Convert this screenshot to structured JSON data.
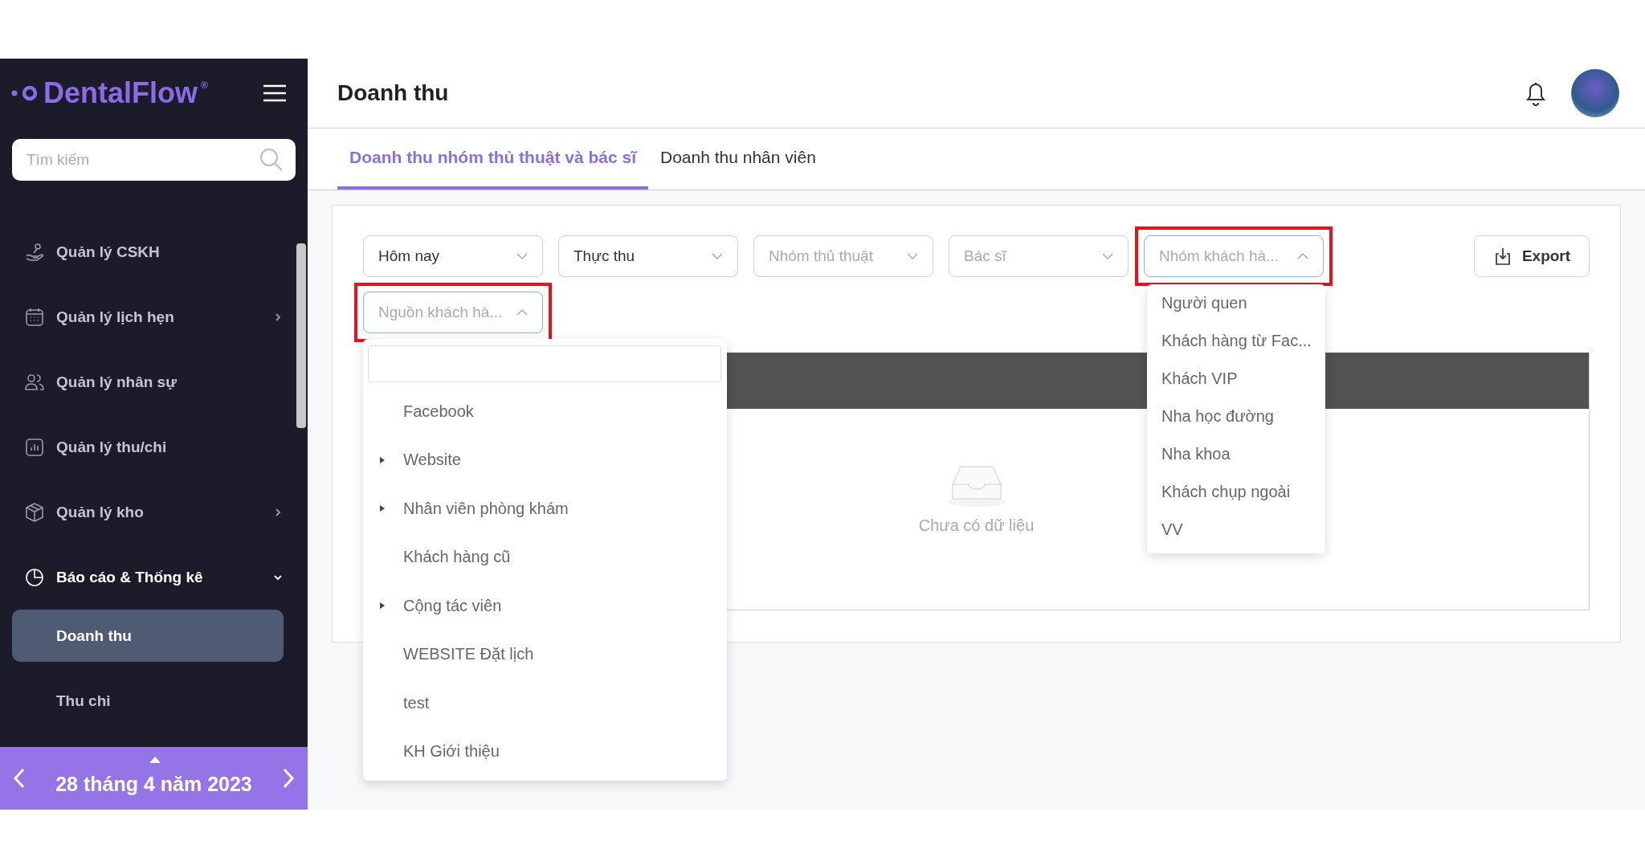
{
  "sidebar": {
    "logo": "DentalFlow",
    "logo_mark": "®",
    "search": {
      "placeholder": "Tìm kiếm"
    },
    "items": [
      {
        "kind": "care",
        "label": "Quản lý CSKH",
        "has_submenu": false,
        "expanded": false
      },
      {
        "kind": "calendar",
        "label": "Quản lý lịch hẹn",
        "has_submenu": true,
        "expanded": false
      },
      {
        "kind": "staff",
        "label": "Quản lý nhân sự",
        "has_submenu": false,
        "expanded": false
      },
      {
        "kind": "finance",
        "label": "Quản lý thu/chi",
        "has_submenu": false,
        "expanded": false
      },
      {
        "kind": "warehouse",
        "label": "Quản lý kho",
        "has_submenu": true,
        "expanded": false
      },
      {
        "kind": "report",
        "label": "Báo cáo & Thống kê",
        "has_submenu": true,
        "expanded": true,
        "children": [
          {
            "label": "Doanh thu",
            "selected": true
          },
          {
            "label": "Thu chi",
            "selected": false
          }
        ]
      }
    ],
    "date": "28 tháng 4 năm 2023"
  },
  "header": {
    "title": "Doanh thu"
  },
  "tabs": [
    {
      "label": "Doanh thu nhóm thủ thuật và bác sĩ",
      "selected": true
    },
    {
      "label": "Doanh thu nhân viên",
      "selected": false
    }
  ],
  "filters": [
    {
      "value": "Hôm nay",
      "open": false,
      "highlighted": false
    },
    {
      "value": "Thực thu",
      "open": false,
      "highlighted": false
    },
    {
      "placeholder": "Nhóm thủ thuật",
      "open": false,
      "highlighted": false
    },
    {
      "placeholder": "Bác sĩ",
      "open": false,
      "highlighted": false
    },
    {
      "placeholder": "Nhóm khách hà...",
      "open": true,
      "highlighted": true,
      "options": [
        {
          "label": "Người quen"
        },
        {
          "label": "Khách hàng từ Fac..."
        },
        {
          "label": "Khách VIP"
        },
        {
          "label": "Nha học đường"
        },
        {
          "label": "Nha khoa"
        },
        {
          "label": "Khách chụp ngoài"
        },
        {
          "label": "VV"
        }
      ]
    },
    {
      "placeholder": "Nguồn khách hà...",
      "open": true,
      "highlighted": true,
      "searchable": true,
      "options": [
        {
          "label": "Facebook",
          "has_children": false
        },
        {
          "label": "Website",
          "has_children": true
        },
        {
          "label": "Nhân viên phòng khám",
          "has_children": true
        },
        {
          "label": "Khách hàng cũ",
          "has_children": false
        },
        {
          "label": "Cộng tác viên",
          "has_children": true
        },
        {
          "label": "WEBSITE Đặt lịch",
          "has_children": false
        },
        {
          "label": "test",
          "has_children": false
        },
        {
          "label": "KH Giới thiệu",
          "has_children": false
        }
      ]
    }
  ],
  "export_button": "Export",
  "table": {
    "empty_text": "Chưa có dữ liệu"
  }
}
